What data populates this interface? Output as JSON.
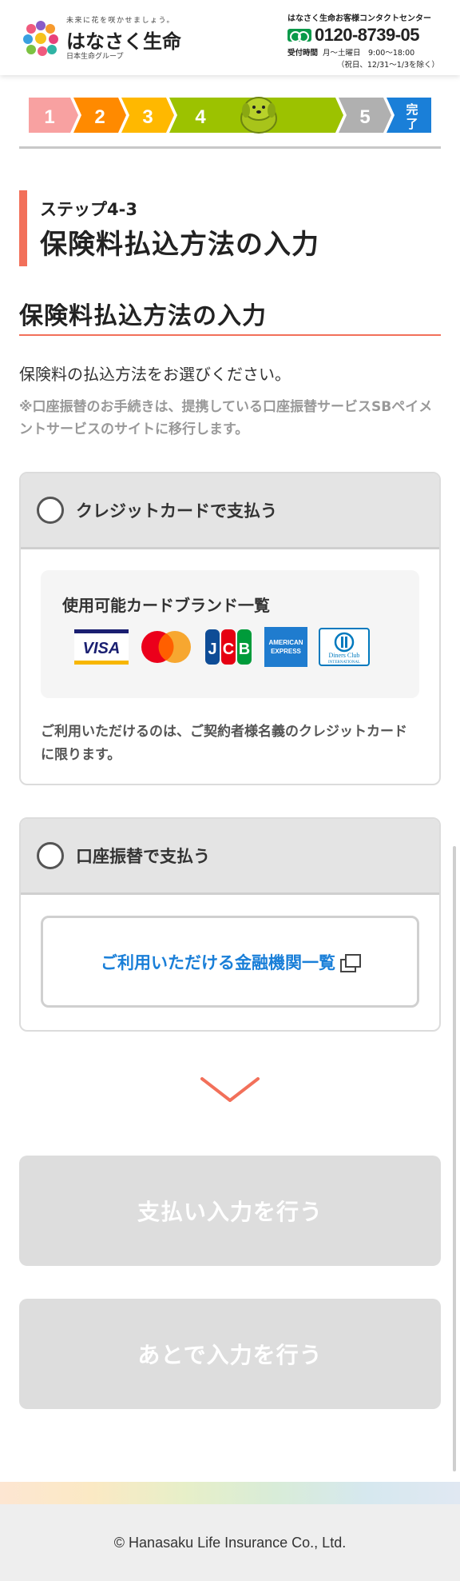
{
  "header": {
    "tagline": "未来に花を咲かせましょう。",
    "brand_name": "はなさく生命",
    "group_name": "日本生命グループ",
    "contact_title": "はなさく生命お客様コンタクトセンター",
    "phone": "0120-8739-05",
    "hours_label": "受付時間",
    "hours_value": "月〜土曜日　9:00〜18:00",
    "hours_note": "（祝日、12/31〜1/3を除く）"
  },
  "progress": {
    "steps": [
      "1",
      "2",
      "3",
      "4",
      "5",
      "完了"
    ],
    "current_step": 4,
    "colors": [
      "#f8a1a1",
      "#ff8a00",
      "#ffb800",
      "#9cc200",
      "#b0b0b0",
      "#1a7fd8"
    ]
  },
  "step": {
    "label": "ステップ4-3",
    "title": "保険料払込方法の入力"
  },
  "section": {
    "title": "保険料払込方法の入力",
    "lead": "保険料の払込方法をお選びください。",
    "note": "※口座振替のお手続きは、提携している口座振替サービスSBペイメントサービスのサイトに移行します。"
  },
  "credit_option": {
    "label": "クレジットカードで支払う",
    "brands_title": "使用可能カードブランド一覧",
    "brands": [
      {
        "name": "VISA",
        "icon": "visa-icon"
      },
      {
        "name": "Mastercard",
        "icon": "mastercard-icon"
      },
      {
        "name": "JCB",
        "icon": "jcb-icon"
      },
      {
        "name": "AMERICAN EXPRESS",
        "icon": "amex-icon"
      },
      {
        "name": "Diners Club INTERNATIONAL",
        "icon": "diners-icon"
      }
    ],
    "note": "ご利用いただけるのは、ご契約者様名義のクレジットカードに限ります。"
  },
  "bank_option": {
    "label": "口座振替で支払う",
    "link_label": "ご利用いただける金融機関一覧"
  },
  "buttons": {
    "pay_now": "支払い入力を行う",
    "pay_later": "あとで入力を行う"
  },
  "footer": {
    "copyright": "© Hanasaku Life Insurance Co., Ltd."
  },
  "colors": {
    "accent": "#f2705a",
    "link": "#1a7fd8",
    "disabled_button": "#dddddd"
  }
}
